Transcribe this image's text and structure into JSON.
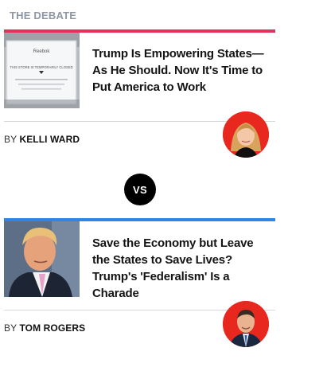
{
  "section": {
    "title": "THE DEBATE"
  },
  "colors": {
    "card1_accent": "#e0325a",
    "card2_accent": "#2f86e6",
    "avatar_bg": "#e8281e"
  },
  "cards": [
    {
      "headline": "Trump Is Empowering States—As He Should. Now It's Time to Put America to Work",
      "byline_prefix": "BY",
      "author": "KELLI WARD",
      "thumb_sign": {
        "brand": "Reebok",
        "line": "THIS STORE IS TEMPORARILY CLOSED"
      }
    },
    {
      "headline": "Save the Economy but Leave the States to Save Lives? Trump's 'Federalism' Is a Charade",
      "byline_prefix": "BY",
      "author": "TOM ROGERS"
    }
  ],
  "vs_label": "VS"
}
